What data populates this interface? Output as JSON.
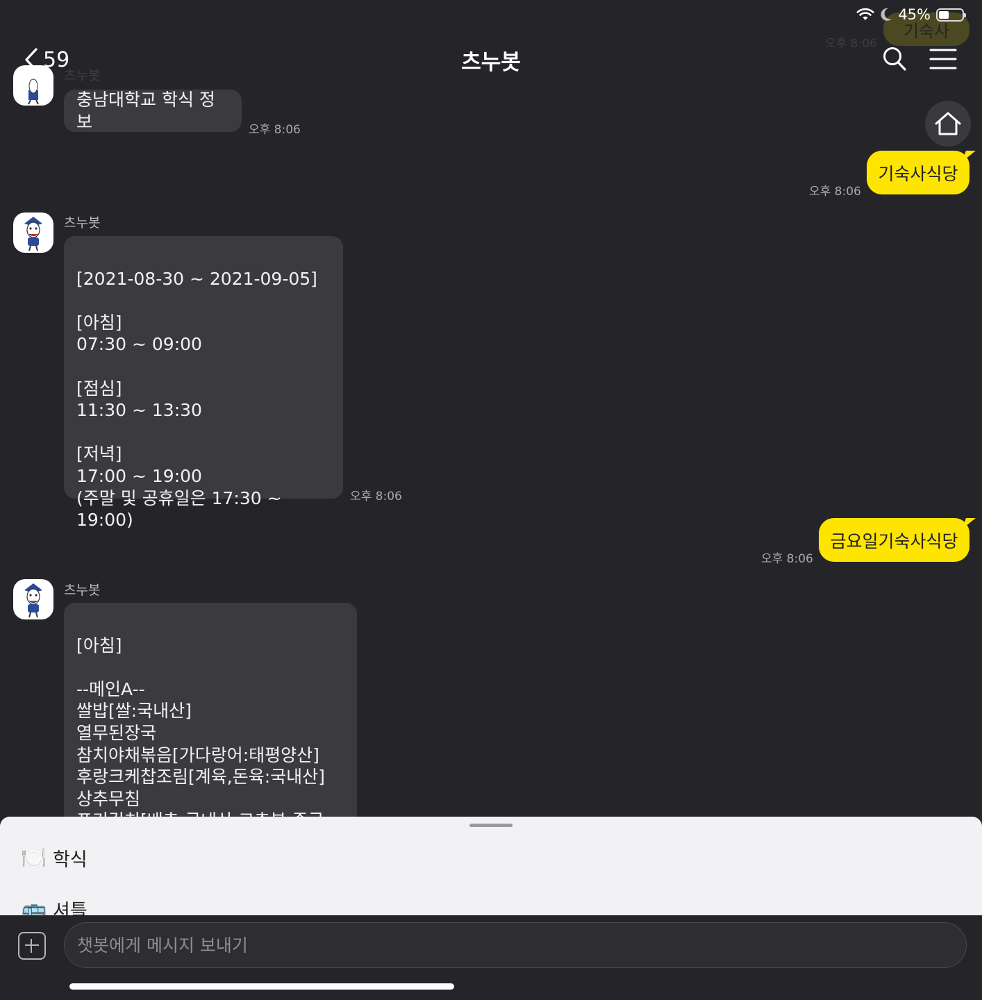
{
  "status_bar": {
    "battery_percent_text": "45%",
    "battery_level": 0.45,
    "icons": [
      "wifi-icon",
      "moon-icon",
      "battery-icon"
    ]
  },
  "header": {
    "back_count": "59",
    "title": "츠누봇",
    "icons": [
      "chevron-left-icon",
      "search-icon",
      "menu-icon",
      "home-icon"
    ]
  },
  "ghost": {
    "sender": "츠누봇",
    "time": "오후 8:06",
    "reply": "기숙사"
  },
  "messages": [
    {
      "type": "in",
      "text": "충남대학교 학식 정보",
      "time": "오후 8:06"
    },
    {
      "type": "out",
      "text": "기숙사식당",
      "time": "오후 8:06"
    },
    {
      "type": "in",
      "sender": "츠누봇",
      "text": "[2021-08-30 ~ 2021-09-05]\n\n[아침]\n07:30 ~ 09:00\n\n[점심]\n11:30 ~ 13:30\n\n[저녁]\n17:00 ~ 19:00\n(주말 및 공휴일은 17:30 ~ 19:00)",
      "time": "오후 8:06"
    },
    {
      "type": "out",
      "text": "금요일기숙사식당",
      "time": "오후 8:06"
    },
    {
      "type": "in",
      "sender": "츠누봇",
      "text": "[아침]\n\n--메인A--\n쌀밥[쌀:국내산]\n열무된장국\n참치야채볶음[가다랑어:태평양산]\n후랑크케찹조림[계육,돈육:국내산]\n상추무침\n포기김치[배추:국내산,고추분:중국산]"
    }
  ],
  "quick_menu": [
    {
      "emoji": "🍽️",
      "label": "학식"
    },
    {
      "emoji": "🚌",
      "label": "셔틀"
    }
  ],
  "input": {
    "placeholder": "챗봇에게 메시지 보내기",
    "value": ""
  },
  "colors": {
    "background": "#252529",
    "bubble_in": "#3b3b3f",
    "bubble_out": "#fee500",
    "sheet": "#f2f2f4"
  }
}
